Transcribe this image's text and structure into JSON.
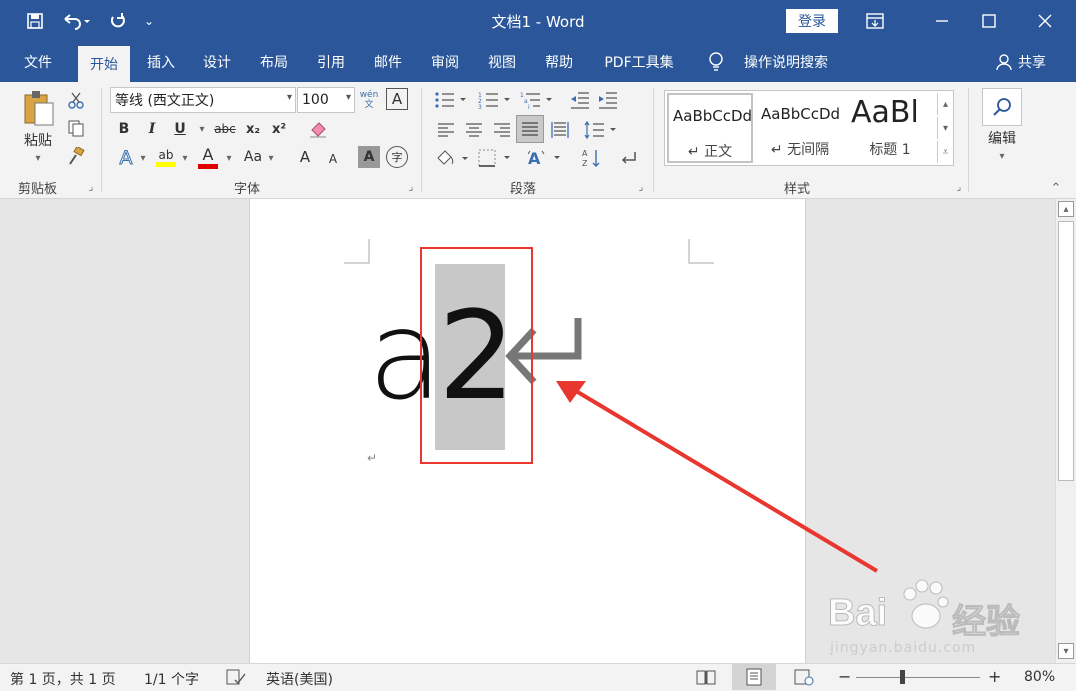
{
  "titlebar": {
    "title": "文档1  -  Word",
    "login": "登录"
  },
  "qat": {
    "save": "save-icon",
    "undo": "undo-icon",
    "redo": "redo-icon"
  },
  "tabs": [
    "文件",
    "开始",
    "插入",
    "设计",
    "布局",
    "引用",
    "邮件",
    "审阅",
    "视图",
    "帮助",
    "PDF工具集"
  ],
  "search": {
    "label": "操作说明搜索"
  },
  "share": "共享",
  "clipboard": {
    "paste": "粘贴",
    "group": "剪贴板"
  },
  "font": {
    "name": "等线 (西文正文)",
    "size": "100",
    "group": "字体",
    "wen": "wén\n文",
    "bold": "B",
    "italic": "I",
    "underline": "U",
    "strike": "abc",
    "sub": "x₂",
    "sup": "x²",
    "aa": "Aa",
    "grow": "A",
    "shrink": "A",
    "boxA": "A",
    "circle": "字",
    "effectA": "A",
    "highlight": "ab",
    "colorA": "A"
  },
  "paragraph": {
    "group": "段落"
  },
  "styles": {
    "group": "样式",
    "items": [
      {
        "sample": "AaBbCcDd",
        "name": "↵ 正文"
      },
      {
        "sample": "AaBbCcDd",
        "name": "↵ 无间隔"
      },
      {
        "sample": "AaBl",
        "name": "标题 1"
      }
    ]
  },
  "editing": {
    "label": "编辑"
  },
  "document": {
    "text_a": "a",
    "text_2": "2",
    "para_mark": "↵",
    "small_mark": "↵"
  },
  "status": {
    "page": "第 1 页，共 1 页",
    "words": "1/1 个字",
    "lang": "英语(美国)",
    "zoom": "80%"
  },
  "watermark": {
    "brand": "Bai",
    "brand2": "经验",
    "url": "jingyan.baidu.com"
  },
  "colors": {
    "accent": "#2b579a",
    "annotation": "#e8372f",
    "highlight": "#c8c8c8"
  }
}
